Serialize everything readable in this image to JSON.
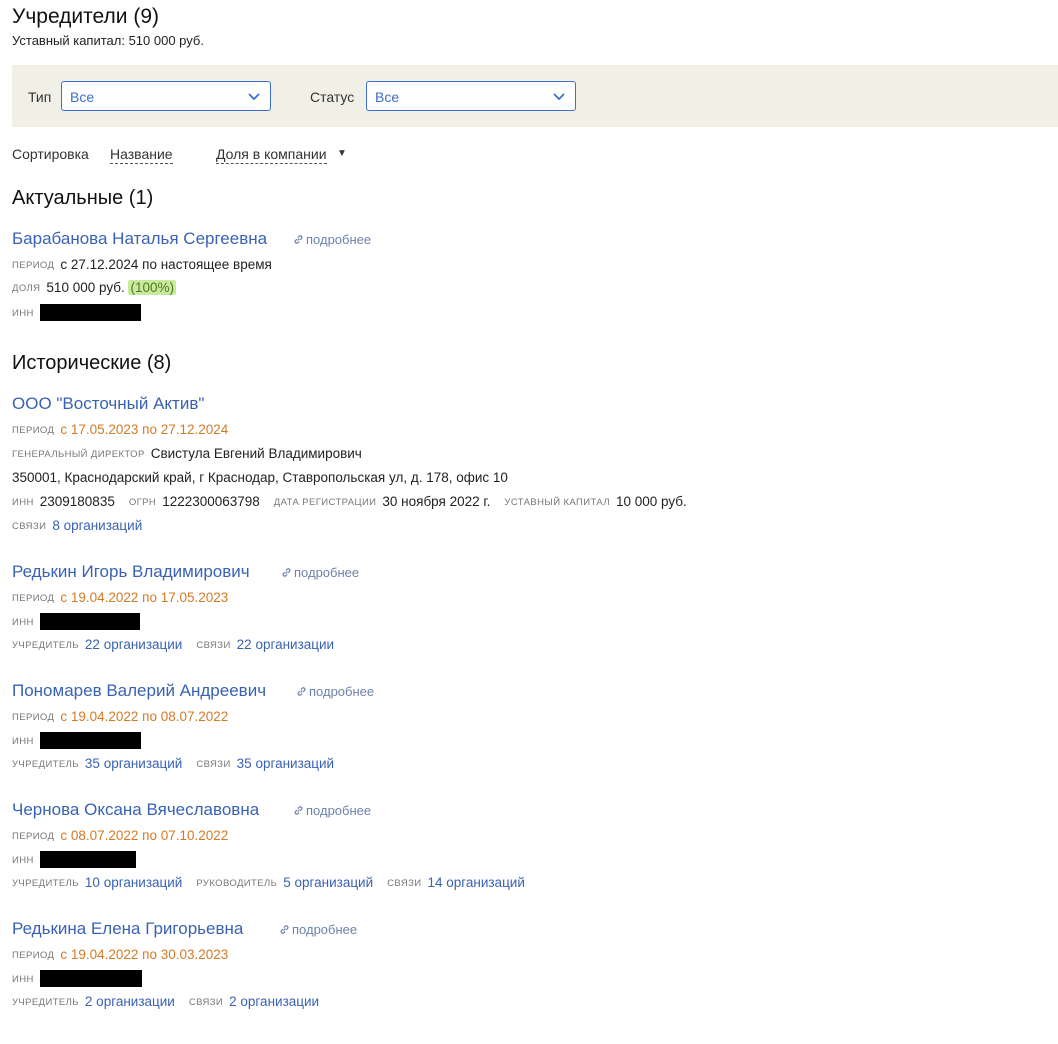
{
  "header": {
    "title": "Учредители (9)",
    "capital": "Уставный капитал: 510 000 руб."
  },
  "filters": {
    "type_label": "Тип",
    "type_value": "Все",
    "status_label": "Статус",
    "status_value": "Все"
  },
  "sort": {
    "label": "Сортировка",
    "by_name": "Название",
    "by_share": "Доля в компании",
    "arrow": "▼"
  },
  "labels": {
    "period": "период",
    "share": "доля",
    "inn": "инн",
    "ogrn": "огрн",
    "director": "генеральный директор",
    "reg_date": "дата регистрации",
    "capital": "уставный капитал",
    "links": "связи",
    "founder": "учредитель",
    "manager": "руководитель",
    "more": "подробнее"
  },
  "current": {
    "title": "Актуальные (1)",
    "person": {
      "name": "Барабанова Наталья Сергеевна",
      "period": "с 27.12.2024 по настоящее время",
      "share": "510 000 руб.",
      "share_pct": "(100%)"
    }
  },
  "historic": {
    "title": "Исторические (8)",
    "company": {
      "name": "ООО \"Восточный Актив\"",
      "period": "с 17.05.2023 по 27.12.2024",
      "director": "Свистула Евгений Владимирович",
      "address": "350001, Краснодарский край, г Краснодар, Ставропольская ул, д. 178, офис 10",
      "inn": "2309180835",
      "ogrn": "1222300063798",
      "reg_date": "30 ноября 2022 г.",
      "capital": "10 000 руб.",
      "links": "8 организаций"
    },
    "persons": [
      {
        "name": "Редькин Игорь Владимирович",
        "period": "с 19.04.2022 по 17.05.2023",
        "founder": "22 организации",
        "links": "22 организации"
      },
      {
        "name": "Пономарев Валерий Андреевич",
        "period": "с 19.04.2022 по 08.07.2022",
        "founder": "35 организаций",
        "links": "35 организаций"
      },
      {
        "name": "Чернова Оксана Вячеславовна",
        "period": "с 08.07.2022 по 07.10.2022",
        "founder": "10 организаций",
        "manager": "5 организаций",
        "links": "14 организаций"
      },
      {
        "name": "Редькина Елена Григорьевна",
        "period": "с 19.04.2022 по 30.03.2023",
        "founder": "2 организации",
        "links": "2 организации"
      }
    ]
  },
  "colors": {
    "link": "#3a62b4",
    "period_historic": "#d47a25",
    "filter_bg": "#f1f0e6",
    "select_border": "#3d6fd2",
    "share_badge_bg": "#c9ea9e"
  }
}
